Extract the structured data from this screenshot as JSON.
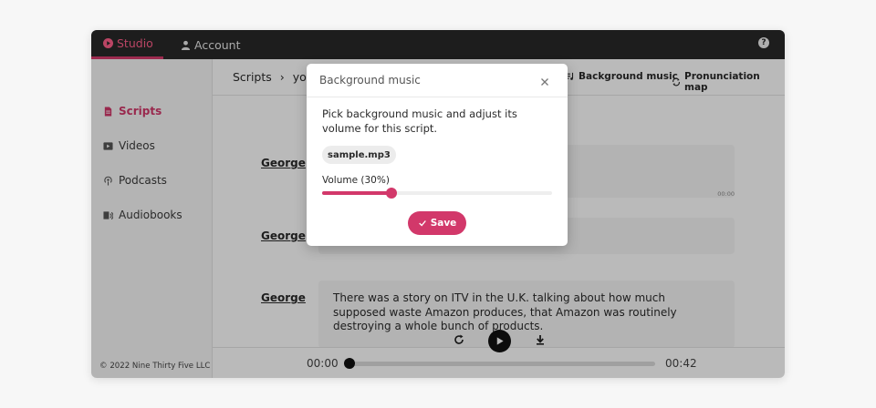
{
  "topbar": {
    "tabs": [
      {
        "label": "Studio",
        "icon": "play-circle-icon"
      },
      {
        "label": "Account",
        "icon": "user-icon"
      }
    ],
    "help_icon": "help-icon"
  },
  "sidebar": {
    "items": [
      {
        "label": "Scripts",
        "icon": "document-icon",
        "active": true
      },
      {
        "label": "Videos",
        "icon": "video-icon",
        "active": false
      },
      {
        "label": "Podcasts",
        "icon": "podcast-icon",
        "active": false
      },
      {
        "label": "Audiobooks",
        "icon": "audiobook-icon",
        "active": false
      }
    ],
    "copyright": "© 2022 Nine Thirty Five LLC"
  },
  "toolbar": {
    "breadcrumb": [
      "Scripts",
      "›",
      "yout"
    ],
    "background_music_label": "Background music",
    "pronunciation_map_label": "Pronunciation map"
  },
  "script_blocks": [
    {
      "speaker": "George",
      "text": "",
      "timestamp": "00:00"
    },
    {
      "speaker": "George",
      "text": "",
      "timestamp": ""
    },
    {
      "speaker": "George",
      "text": "There was a story on ITV in the U.K. talking about how much supposed waste Amazon produces, that Amazon was routinely destroying a whole bunch of products.",
      "timestamp": ""
    }
  ],
  "player": {
    "current_time": "00:00",
    "duration": "00:42",
    "progress": 0
  },
  "modal": {
    "title": "Background music",
    "description": "Pick background music and adjust its volume for this script.",
    "file_chip": "sample.mp3",
    "volume_label": "Volume (30%)",
    "volume_fraction": 0.3,
    "save_label": "Save"
  },
  "colors": {
    "accent": "#d2386a",
    "topbar_bg": "#292929",
    "sidebar_bg": "#f7f7f7"
  }
}
